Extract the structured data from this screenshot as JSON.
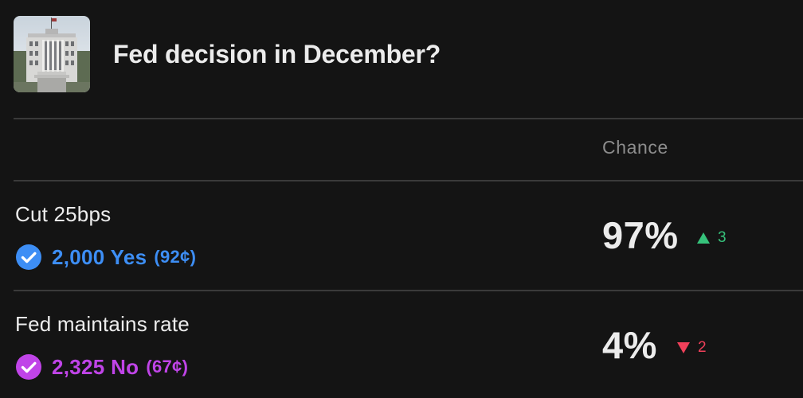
{
  "market": {
    "title": "Fed decision in December?",
    "image_icon": "federal-reserve-building-photo"
  },
  "table": {
    "chance_header": "Chance"
  },
  "outcomes": [
    {
      "name": "Cut 25bps",
      "position_text": "2,000 Yes",
      "position_price": "(92¢)",
      "chance": "97%",
      "change": "3",
      "change_direction": "up",
      "position_color": "#3d8ef5",
      "change_color": "#36c27b"
    },
    {
      "name": "Fed maintains rate",
      "position_text": "2,325 No",
      "position_price": "(67¢)",
      "chance": "4%",
      "change": "2",
      "change_direction": "down",
      "position_color": "#c044e8",
      "change_color": "#f0405a"
    }
  ],
  "colors": {
    "background": "#141414",
    "divider": "#3a3a3a",
    "muted_text": "#8d8d8d",
    "primary_text": "#ececec"
  }
}
